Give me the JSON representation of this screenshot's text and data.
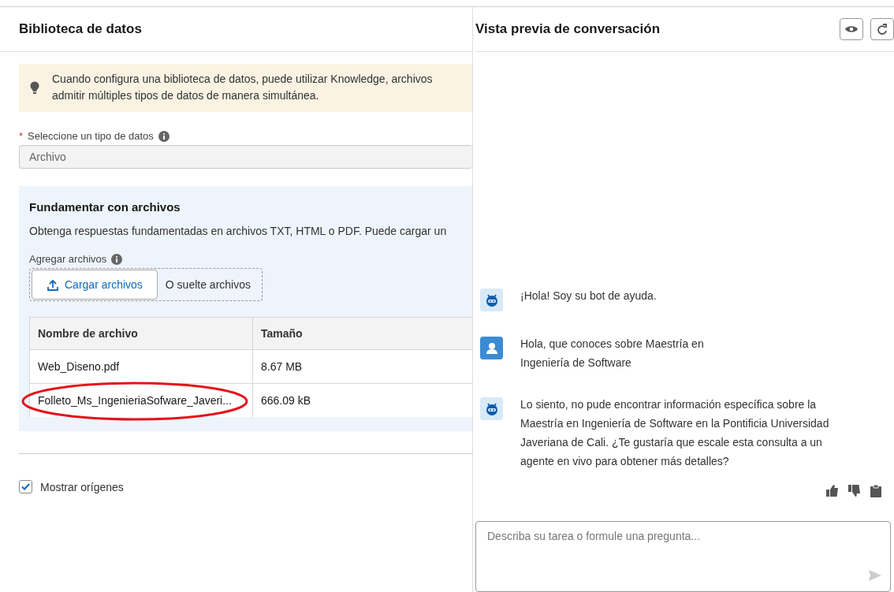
{
  "library": {
    "title": "Biblioteca de datos",
    "alert": {
      "lines": [
        "Cuando configura una biblioteca de datos, puede utilizar Knowledge, archivos",
        "admitir múltiples tipos de datos de manera simultánea."
      ]
    },
    "data_type": {
      "label": "Seleccione un tipo de datos",
      "required_mark": "*",
      "value": "Archivo"
    },
    "files_card": {
      "title": "Fundamentar con archivos",
      "description": "Obtenga respuestas fundamentadas en archivos TXT, HTML o PDF. Puede cargar un",
      "add_label": "Agregar archivos",
      "upload_button": "Cargar archivos",
      "drop_hint": "O suelte archivos",
      "table": {
        "columns": [
          "Nombre de archivo",
          "Tamaño"
        ],
        "rows": [
          {
            "cells": [
              "Web_Diseno.pdf",
              "8.67 MB"
            ],
            "highlighted": false
          },
          {
            "cells": [
              "Folleto_Ms_IngenieriaSofware_Javeri...",
              "666.09 kB"
            ],
            "highlighted": true
          }
        ]
      }
    },
    "show_sources": {
      "label": "Mostrar orígenes",
      "checked": true
    }
  },
  "preview": {
    "title": "Vista previa de conversación",
    "messages": [
      {
        "kind": "bot",
        "text": "¡Hola! Soy su bot de ayuda."
      },
      {
        "kind": "user",
        "text": "Hola, que conoces sobre Maestría en Ingeniería de Software"
      },
      {
        "kind": "bot",
        "text": "Lo siento, no pude encontrar información específica sobre la Maestría en Ingeniería de Software en la Pontificia Universidad Javeriana de Cali. ¿Te gustaría que escale esta consulta a un agente en vivo para obtener más detalles?"
      }
    ],
    "input": {
      "placeholder": "Describa su tarea o formule una pregunta..."
    }
  }
}
